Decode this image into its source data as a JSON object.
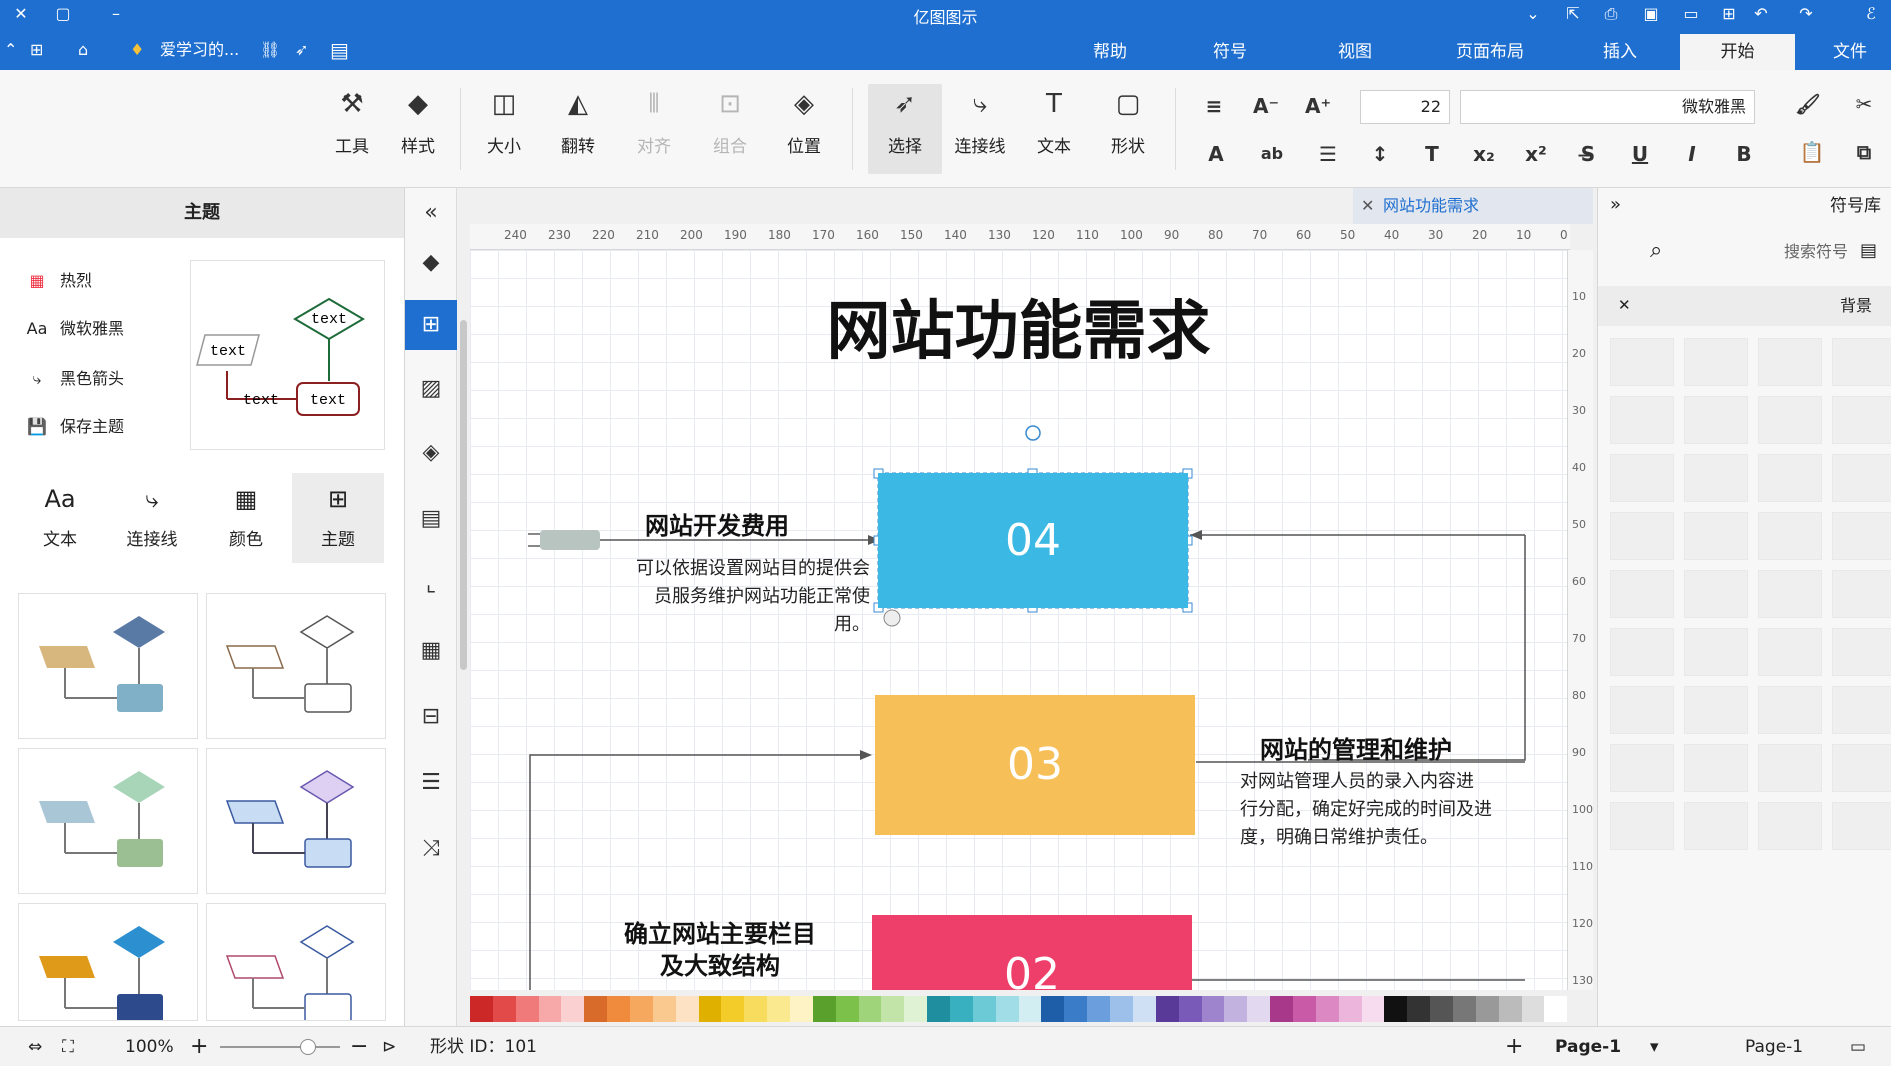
{
  "app_title": "亿图图示",
  "menu": {
    "file": "文件",
    "start": "开始",
    "insert": "插入",
    "page_layout": "页面布局",
    "view": "视图",
    "symbols": "符号",
    "help": "帮助"
  },
  "quick_access": {
    "doc_label": "爱学习的..."
  },
  "ribbon": {
    "font_name": "微软雅黑",
    "font_size": "22",
    "shape": "形状",
    "text": "文本",
    "connector": "连接线",
    "select": "选择",
    "position": "位置",
    "group": "组合",
    "align": "对齐",
    "flip": "翻转",
    "size": "大小",
    "style": "样式",
    "tools": "工具"
  },
  "left_panel": {
    "header": "主题",
    "options": [
      "热烈",
      "微软雅黑",
      "黑色箭头",
      "保存主题"
    ],
    "categories": [
      "主题",
      "颜色",
      "连接线",
      "文本"
    ],
    "preview_text": [
      "text",
      "text",
      "text",
      "text"
    ]
  },
  "doc_tab": {
    "title": "网站功能需求"
  },
  "ruler_h": [
    "0",
    "10",
    "20",
    "30",
    "40",
    "50",
    "60",
    "70",
    "80",
    "90",
    "100",
    "110",
    "120",
    "130",
    "140",
    "150",
    "160",
    "170",
    "180",
    "190",
    "200",
    "210",
    "220",
    "230",
    "240"
  ],
  "ruler_v": [
    "10",
    "20",
    "30",
    "40",
    "50",
    "60",
    "70",
    "80",
    "90",
    "100",
    "110",
    "120",
    "130"
  ],
  "diagram": {
    "title": "网站功能需求",
    "steps": [
      {
        "number": "04",
        "title": "网站开发费用",
        "desc": [
          "可以依据设置网站目的提供会",
          "员服务维护网站功能正常使",
          "用。"
        ],
        "color": "#3bb8e3"
      },
      {
        "number": "03",
        "title": "网站的管理和维护",
        "desc": [
          "对网站管理人员的录入内容进",
          "行分配，确定好完成的时间及进",
          "度，明确日常维护责任。"
        ],
        "color": "#f6bf57"
      },
      {
        "number": "02",
        "title": "确立网站主要栏目及大致结构",
        "title_lines": [
          "确立网站主要栏目",
          "及大致结构"
        ],
        "desc": [],
        "color": "#ee3f6a"
      }
    ]
  },
  "right_panel": {
    "header": "符号库",
    "search_placeholder": "搜索符号",
    "section": "背景"
  },
  "status": {
    "page_selector": "Page-1",
    "page_tab": "Page-1",
    "add_page": "+",
    "shape_id": "形状 ID：101",
    "zoom": "100%"
  },
  "colors": {
    "accent": "#1e6fd0",
    "palette": [
      "#cc2828",
      "#e24a4a",
      "#f07a7a",
      "#f7a8a8",
      "#fbd0d0",
      "#d86a2a",
      "#f08a3c",
      "#f5a85e",
      "#f9c990",
      "#fde3c4",
      "#e0b000",
      "#f3cc2a",
      "#f8dc5e",
      "#fbe98f",
      "#fdf3c4",
      "#5aa02c",
      "#7cc24a",
      "#a0d47a",
      "#c2e4a8",
      "#e0f2d4",
      "#1f8fa0",
      "#38b0c0",
      "#6ccad6",
      "#a0dde6",
      "#d2eef2",
      "#1e5ea8",
      "#3a7cc8",
      "#6a9edc",
      "#9cc0ea",
      "#cfe0f5",
      "#5a3a98",
      "#7a5ab8",
      "#9e84cc",
      "#c2b2e0",
      "#e2d9f0",
      "#a8388a",
      "#c85aa8",
      "#dc88c2",
      "#ecb6dc",
      "#f6dcee",
      "#111111",
      "#333333",
      "#555555",
      "#777777",
      "#999999",
      "#bbbbbb",
      "#dddddd",
      "#ffffff"
    ]
  }
}
